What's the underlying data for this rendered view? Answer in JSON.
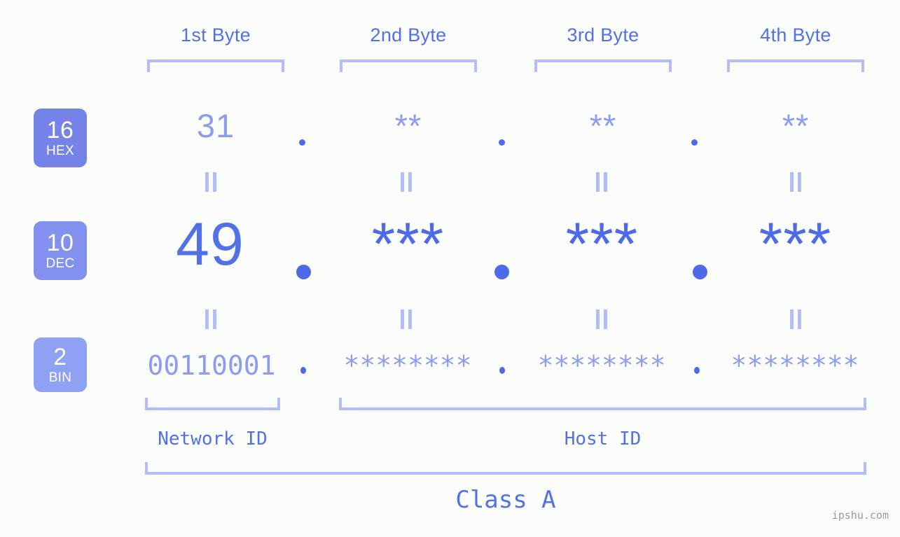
{
  "meta": {
    "watermark": "ipshu.com",
    "background_color": "#fbfdfa",
    "accent_dark": "#4e6ae8",
    "accent_mid": "#5271e8",
    "accent_light": "#8d9cf0",
    "accent_pale": "#b3bdfa"
  },
  "byte_headers": [
    {
      "label": "1st Byte"
    },
    {
      "label": "2nd Byte"
    },
    {
      "label": "3rd Byte"
    },
    {
      "label": "4th Byte"
    }
  ],
  "bases": [
    {
      "number": "16",
      "name": "HEX",
      "color": "#7583e8"
    },
    {
      "number": "10",
      "name": "DEC",
      "color": "#8490ee"
    },
    {
      "number": "2",
      "name": "BIN",
      "color": "#8fa1f2"
    }
  ],
  "rows": {
    "hex": {
      "base": "16",
      "values": [
        "31",
        "**",
        "**",
        "**"
      ],
      "separator": "."
    },
    "dec": {
      "base": "10",
      "values": [
        "49",
        "***",
        "***",
        "***"
      ],
      "separator": "."
    },
    "bin": {
      "base": "2",
      "values": [
        "00110001",
        "********",
        "********",
        "********"
      ],
      "separator": "."
    }
  },
  "equals_symbol": "||",
  "footer": {
    "network_id_label": "Network ID",
    "host_id_label": "Host ID",
    "class_label": "Class A"
  }
}
